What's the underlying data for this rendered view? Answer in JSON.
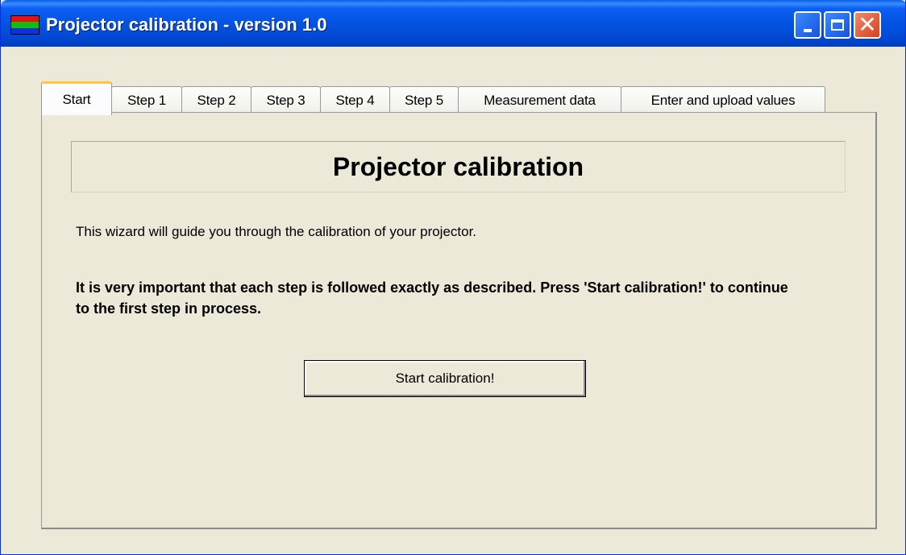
{
  "window": {
    "title": "Projector calibration - version 1.0",
    "icon": "app-color-bars-icon",
    "controls": [
      "minimize-icon",
      "maximize-icon",
      "close-icon"
    ],
    "colors": {
      "titlebar": "#0353e0",
      "close": "#d6401c",
      "face": "#ece9d8"
    }
  },
  "tabs": [
    {
      "label": "Start",
      "active": true
    },
    {
      "label": "Step 1"
    },
    {
      "label": "Step 2"
    },
    {
      "label": "Step 3"
    },
    {
      "label": "Step 4"
    },
    {
      "label": "Step 5"
    },
    {
      "label": "Measurement data"
    },
    {
      "label": "Enter and upload values"
    }
  ],
  "main": {
    "heading": "Projector calibration",
    "intro": "This wizard will guide you through the calibration of your projector.",
    "important": "It is very important that each step is followed exactly as described. Press 'Start calibration!' to continue to the first step in process.",
    "start_button": "Start calibration!"
  }
}
